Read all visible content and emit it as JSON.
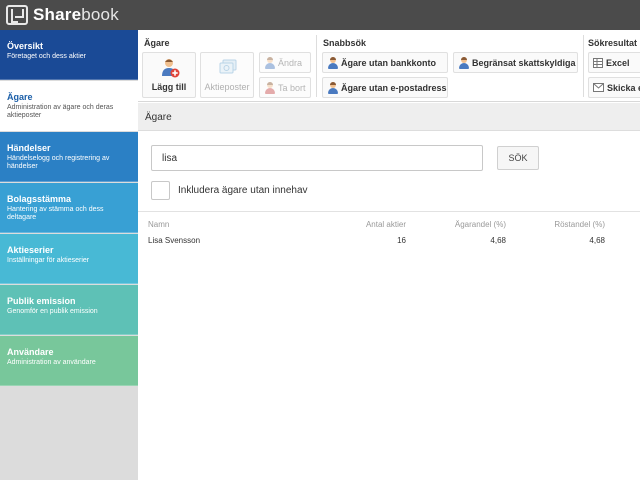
{
  "app": {
    "logo_bold": "Share",
    "logo_light": "book"
  },
  "sidebar": {
    "items": [
      {
        "title": "Översikt",
        "subtitle": "Företaget och dess aktier",
        "color": "#1a4a96"
      },
      {
        "title": "Ägare",
        "subtitle": "Administration av ägare och deras aktieposter",
        "color": "#ffffff"
      },
      {
        "title": "Händelser",
        "subtitle": "Händelselogg och registrering av händelser",
        "color": "#2b80c5"
      },
      {
        "title": "Bolagsstämma",
        "subtitle": "Hantering av stämma och dess deltagare",
        "color": "#38a0d4"
      },
      {
        "title": "Aktieserier",
        "subtitle": "Inställningar för aktieserier",
        "color": "#48b9d5"
      },
      {
        "title": "Publik emission",
        "subtitle": "Genomför en publik emission",
        "color": "#5ec1b6"
      },
      {
        "title": "Användare",
        "subtitle": "Administration av användare",
        "color": "#78c79b"
      }
    ]
  },
  "ribbon": {
    "owner_group": {
      "title": "Ägare",
      "add_label": "Lägg till",
      "positions_label": "Aktieposter",
      "edit_label": "Ändra",
      "delete_label": "Ta bort"
    },
    "quick_group": {
      "title": "Snabbsök",
      "no_bank": "Ägare utan bankkonto",
      "limited_tax": "Begränsat skattskyldiga",
      "no_email": "Ägare utan e-postadress"
    },
    "results_group": {
      "title": "Sökresultat",
      "excel": "Excel",
      "send": "Skicka e"
    }
  },
  "content": {
    "header": "Ägare",
    "search_value": "lisa",
    "search_button": "SÖK",
    "include_label": "Inkludera ägare utan innehav"
  },
  "table": {
    "columns": [
      "Namn",
      "Antal aktier",
      "Ägarandel (%)",
      "Röstandel (%)"
    ],
    "rows": [
      [
        "Lisa Svensson",
        "16",
        "4,68",
        "4,68"
      ]
    ]
  }
}
